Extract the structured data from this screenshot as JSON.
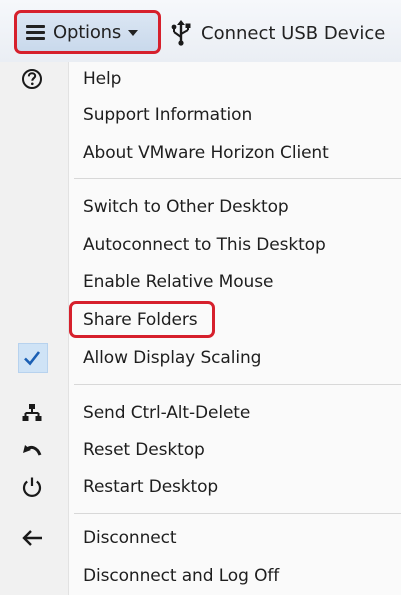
{
  "toolbar": {
    "options_label": "Options",
    "usb_label": "Connect USB Device"
  },
  "menu": {
    "help": "Help",
    "support_information": "Support Information",
    "about": "About VMware Horizon Client",
    "switch_desktop": "Switch to Other Desktop",
    "autoconnect": "Autoconnect to This Desktop",
    "relative_mouse": "Enable Relative Mouse",
    "share_folders": "Share Folders",
    "display_scaling": "Allow Display Scaling",
    "ctrl_alt_delete": "Send Ctrl-Alt-Delete",
    "reset_desktop": "Reset Desktop",
    "restart_desktop": "Restart Desktop",
    "disconnect": "Disconnect",
    "disconnect_logoff": "Disconnect and Log Off"
  },
  "state": {
    "display_scaling_checked": true
  },
  "colors": {
    "highlight": "#d6202c",
    "check": "#1a5fb4",
    "checked_bg": "#cfe3f6"
  },
  "icons": {
    "options": "hamburger-icon",
    "usb": "usb-icon",
    "help": "question-circle-icon",
    "check": "checkmark-icon",
    "ctrl_alt_delete": "network-icon",
    "reset": "undo-arrow-icon",
    "restart": "power-icon",
    "disconnect": "back-arrow-icon"
  }
}
